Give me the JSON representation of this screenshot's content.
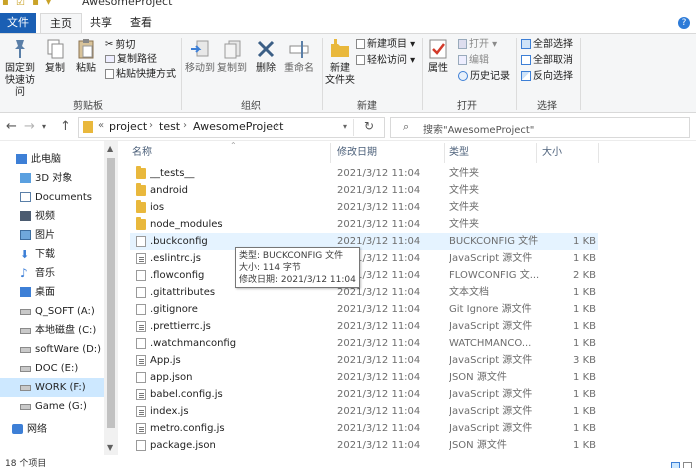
{
  "title_bar": {
    "title": "AwesomeProject"
  },
  "tabs": {
    "file": "文件",
    "home": "主页",
    "share": "共享",
    "view": "查看"
  },
  "ribbon": {
    "clipboard": {
      "pin_quick_access": "固定到\n快速访问",
      "copy": "复制",
      "paste": "粘贴",
      "cut": "剪切",
      "copy_path": "复制路径",
      "paste_shortcut": "粘贴快捷方式",
      "group_label": "剪贴板"
    },
    "organize": {
      "move_to": "移动到",
      "copy_to": "复制到",
      "delete": "删除",
      "rename": "重命名",
      "group_label": "组织"
    },
    "new": {
      "new_folder": "新建\n文件夹",
      "new_item": "新建项目 ▾",
      "easy_access": "轻松访问 ▾",
      "group_label": "新建"
    },
    "open": {
      "properties": "属性",
      "open": "打开 ▾",
      "edit": "编辑",
      "history": "历史记录",
      "group_label": "打开"
    },
    "select": {
      "select_all": "全部选择",
      "select_none": "全部取消",
      "invert": "反向选择",
      "group_label": "选择"
    }
  },
  "address": {
    "breadcrumbs": [
      "project",
      "test",
      "AwesomeProject"
    ],
    "overflow": "«",
    "search_placeholder": "搜索\"AwesomeProject\""
  },
  "nav_pane": [
    {
      "label": "此电脑",
      "icon": "pc-icon"
    },
    {
      "label": "3D 对象",
      "icon": "3d-objects-icon"
    },
    {
      "label": "Documents",
      "icon": "documents-icon"
    },
    {
      "label": "视频",
      "icon": "video-icon"
    },
    {
      "label": "图片",
      "icon": "pictures-icon"
    },
    {
      "label": "下载",
      "icon": "download-icon"
    },
    {
      "label": "音乐",
      "icon": "music-icon"
    },
    {
      "label": "桌面",
      "icon": "desktop-icon"
    },
    {
      "label": "Q_SOFT (A:)",
      "icon": "drive-icon"
    },
    {
      "label": "本地磁盘 (C:)",
      "icon": "drive-icon"
    },
    {
      "label": "softWare (D:)",
      "icon": "drive-icon"
    },
    {
      "label": "DOC (E:)",
      "icon": "drive-icon"
    },
    {
      "label": "WORK (F:)",
      "icon": "drive-icon"
    },
    {
      "label": "Game (G:)",
      "icon": "drive-icon"
    },
    {
      "label": "网络",
      "icon": "network-icon"
    }
  ],
  "columns": {
    "name": "名称",
    "modified": "修改日期",
    "type": "类型",
    "size": "大小"
  },
  "files": [
    {
      "name": "__tests__",
      "modified": "2021/3/12 11:04",
      "type": "文件夹",
      "size": "",
      "kind": "folder"
    },
    {
      "name": "android",
      "modified": "2021/3/12 11:04",
      "type": "文件夹",
      "size": "",
      "kind": "folder"
    },
    {
      "name": "ios",
      "modified": "2021/3/12 11:04",
      "type": "文件夹",
      "size": "",
      "kind": "folder"
    },
    {
      "name": "node_modules",
      "modified": "2021/3/12 11:04",
      "type": "文件夹",
      "size": "",
      "kind": "folder"
    },
    {
      "name": ".buckconfig",
      "modified": "2021/3/12 11:04",
      "type": "BUCKCONFIG 文件",
      "size": "1 KB",
      "kind": "doc"
    },
    {
      "name": ".eslintrc.js",
      "modified": "2021/3/12 11:04",
      "type": "JavaScript 源文件",
      "size": "1 KB",
      "kind": "js"
    },
    {
      "name": ".flowconfig",
      "modified": "2021/3/12 11:04",
      "type": "FLOWCONFIG 文...",
      "size": "2 KB",
      "kind": "doc"
    },
    {
      "name": ".gitattributes",
      "modified": "2021/3/12 11:04",
      "type": "文本文档",
      "size": "1 KB",
      "kind": "doc"
    },
    {
      "name": ".gitignore",
      "modified": "2021/3/12 11:04",
      "type": "Git Ignore 源文件",
      "size": "1 KB",
      "kind": "doc"
    },
    {
      "name": ".prettierrc.js",
      "modified": "2021/3/12 11:04",
      "type": "JavaScript 源文件",
      "size": "1 KB",
      "kind": "js"
    },
    {
      "name": ".watchmanconfig",
      "modified": "2021/3/12 11:04",
      "type": "WATCHMANCO...",
      "size": "1 KB",
      "kind": "doc"
    },
    {
      "name": "App.js",
      "modified": "2021/3/12 11:04",
      "type": "JavaScript 源文件",
      "size": "3 KB",
      "kind": "js"
    },
    {
      "name": "app.json",
      "modified": "2021/3/12 11:04",
      "type": "JSON 源文件",
      "size": "1 KB",
      "kind": "doc"
    },
    {
      "name": "babel.config.js",
      "modified": "2021/3/12 11:04",
      "type": "JavaScript 源文件",
      "size": "1 KB",
      "kind": "js"
    },
    {
      "name": "index.js",
      "modified": "2021/3/12 11:04",
      "type": "JavaScript 源文件",
      "size": "1 KB",
      "kind": "js"
    },
    {
      "name": "metro.config.js",
      "modified": "2021/3/12 11:04",
      "type": "JavaScript 源文件",
      "size": "1 KB",
      "kind": "js"
    },
    {
      "name": "package.json",
      "modified": "2021/3/12 11:04",
      "type": "JSON 源文件",
      "size": "1 KB",
      "kind": "doc"
    }
  ],
  "tooltip": {
    "type": "类型: BUCKCONFIG 文件",
    "size": "大小: 114 字节",
    "modified": "修改日期: 2021/3/12 11:04"
  },
  "status": {
    "item_count": "18 个项目"
  },
  "colors": {
    "accent": "#1a5fb4",
    "folder": "#e9b83c",
    "hover": "#e5f3ff",
    "selected": "#cde8ff"
  }
}
